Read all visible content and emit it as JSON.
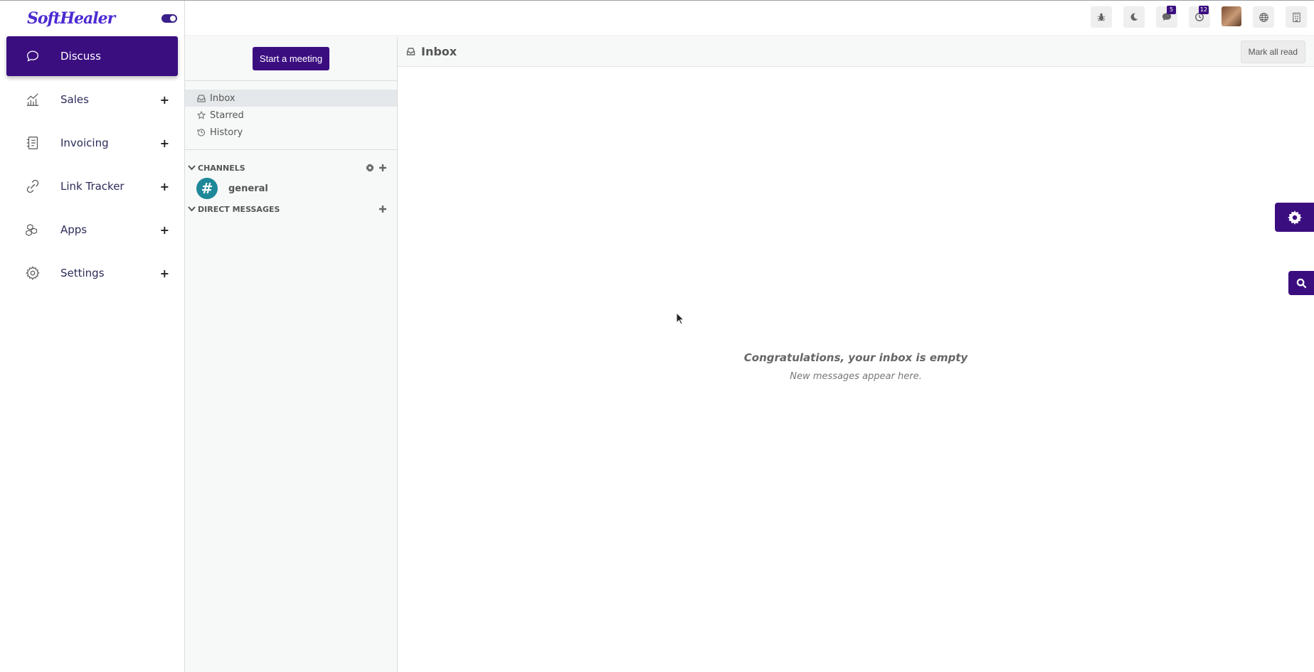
{
  "brand": {
    "logo_text": "SoftHealer",
    "accent": "#3b0e80"
  },
  "sidebar": {
    "items": [
      {
        "label": "Discuss",
        "icon": "chat-bubble-icon",
        "active": true,
        "expandable": false
      },
      {
        "label": "Sales",
        "icon": "chart-line-icon",
        "active": false,
        "expandable": true
      },
      {
        "label": "Invoicing",
        "icon": "invoice-icon",
        "active": false,
        "expandable": true
      },
      {
        "label": "Link Tracker",
        "icon": "link-icon",
        "active": false,
        "expandable": true
      },
      {
        "label": "Apps",
        "icon": "apps-cubes-icon",
        "active": false,
        "expandable": true
      },
      {
        "label": "Settings",
        "icon": "gear-icon",
        "active": false,
        "expandable": true
      }
    ],
    "plus_symbol": "+"
  },
  "topbar": {
    "messages_badge": "5",
    "activities_badge": "12"
  },
  "discuss": {
    "start_meeting_label": "Start a meeting",
    "mailboxes": [
      {
        "label": "Inbox",
        "icon": "inbox-icon",
        "active": true
      },
      {
        "label": "Starred",
        "icon": "star-icon",
        "active": false
      },
      {
        "label": "History",
        "icon": "history-icon",
        "active": false
      }
    ],
    "channels_header": "CHANNELS",
    "channels": [
      {
        "name": "general"
      }
    ],
    "direct_messages_header": "DIRECT MESSAGES"
  },
  "main": {
    "title": "Inbox",
    "mark_all_read_label": "Mark all read",
    "empty_title": "Congratulations, your inbox is empty",
    "empty_subtitle": "New messages appear here."
  }
}
